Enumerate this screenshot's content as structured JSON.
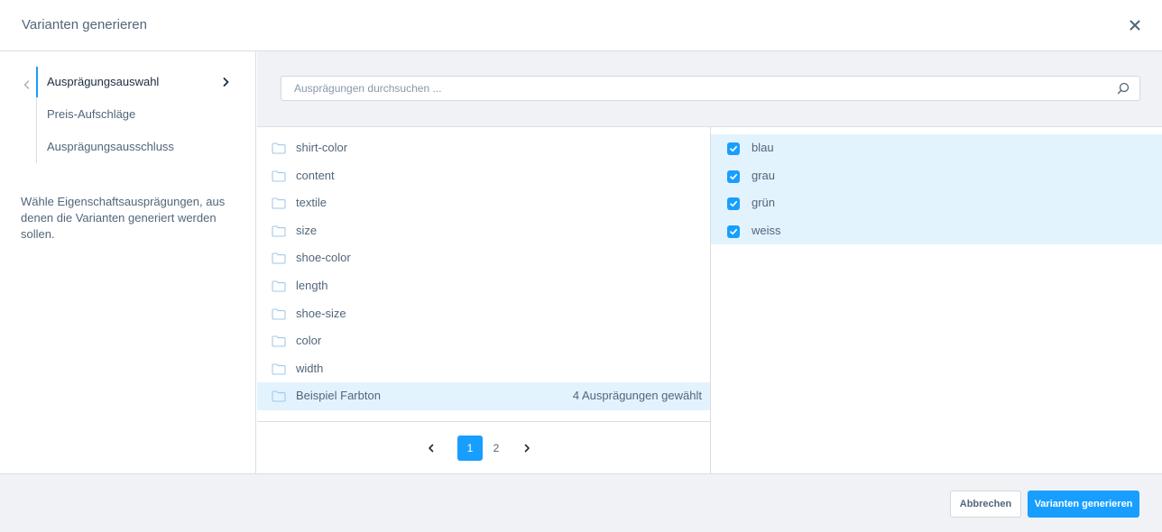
{
  "modal": {
    "title": "Varianten generieren",
    "close_icon": "close-icon"
  },
  "sidebar": {
    "items": [
      {
        "label": "Ausprägungsauswahl",
        "active": true
      },
      {
        "label": "Preis-Aufschläge",
        "active": false
      },
      {
        "label": "Ausprägungsausschluss",
        "active": false
      }
    ],
    "help_text": "Wähle Eigenschaftsausprägungen, aus denen die Varianten generiert werden sollen."
  },
  "search": {
    "placeholder": "Ausprägungen durchsuchen ..."
  },
  "groups": [
    {
      "name": "shirt-color",
      "count": ""
    },
    {
      "name": "content",
      "count": ""
    },
    {
      "name": "textile",
      "count": ""
    },
    {
      "name": "size",
      "count": ""
    },
    {
      "name": "shoe-color",
      "count": ""
    },
    {
      "name": "length",
      "count": ""
    },
    {
      "name": "shoe-size",
      "count": ""
    },
    {
      "name": "color",
      "count": ""
    },
    {
      "name": "width",
      "count": ""
    },
    {
      "name": "Beispiel Farbton",
      "count": "4 Ausprägungen gewählt",
      "selected": true
    }
  ],
  "pagination": {
    "pages": [
      "1",
      "2"
    ],
    "current": "1"
  },
  "options": [
    {
      "label": "blau",
      "checked": true
    },
    {
      "label": "grau",
      "checked": true
    },
    {
      "label": "grün",
      "checked": true
    },
    {
      "label": "weiss",
      "checked": true
    }
  ],
  "footer": {
    "cancel_label": "Abbrechen",
    "submit_label": "Varianten generieren"
  },
  "colors": {
    "accent": "#189eff",
    "selected_bg": "#e3f3fe",
    "panel_bg": "#f0f2f5",
    "text": "#52667a"
  }
}
